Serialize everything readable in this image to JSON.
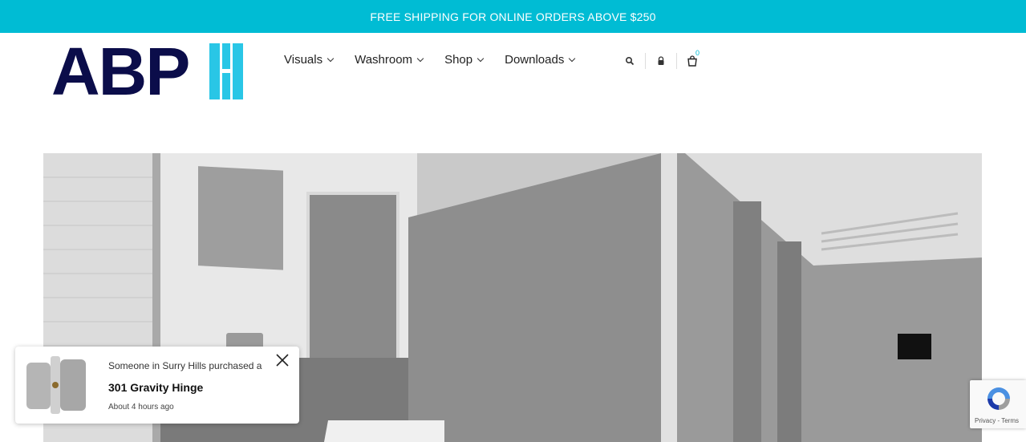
{
  "banner": {
    "text": "FREE SHIPPING FOR ONLINE ORDERS ABOVE $250"
  },
  "logo": {
    "text": "ABP"
  },
  "nav": {
    "items": [
      {
        "label": "Visuals"
      },
      {
        "label": "Washroom"
      },
      {
        "label": "Shop"
      },
      {
        "label": "Downloads"
      }
    ]
  },
  "tools": {
    "cart_count": "0"
  },
  "popup": {
    "line1": "Someone in Surry Hills purchased a",
    "product": "301 Gravity Hinge",
    "time": "About 4 hours ago"
  },
  "recaptcha": {
    "privacy": "Privacy",
    "separator": " - ",
    "terms": "Terms"
  },
  "colors": {
    "accent": "#00bcd4",
    "logo_dark": "#0b0d4a",
    "logo_light": "#29c6e6"
  }
}
